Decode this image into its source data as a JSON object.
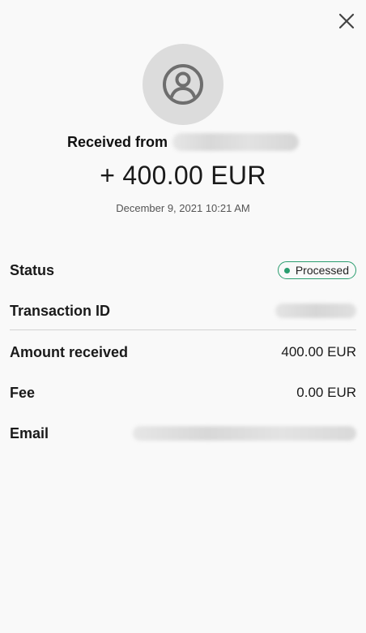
{
  "icons": {
    "close": "close-icon",
    "avatar": "user-avatar-icon"
  },
  "colors": {
    "background": "#f9f9f9",
    "avatar_bg": "#dcdcdc",
    "avatar_icon": "#6e6e6e",
    "status_accent": "#2a9d6f",
    "divider": "#d2d2d2"
  },
  "header": {
    "received_label": "Received from",
    "amount": "+ 400.00 EUR",
    "datetime": "December 9, 2021 10:21 AM"
  },
  "details": {
    "status_label": "Status",
    "status_value": "Processed",
    "transaction_id_label": "Transaction ID",
    "amount_received_label": "Amount received",
    "amount_received_value": "400.00 EUR",
    "fee_label": "Fee",
    "fee_value": "0.00 EUR",
    "email_label": "Email"
  }
}
